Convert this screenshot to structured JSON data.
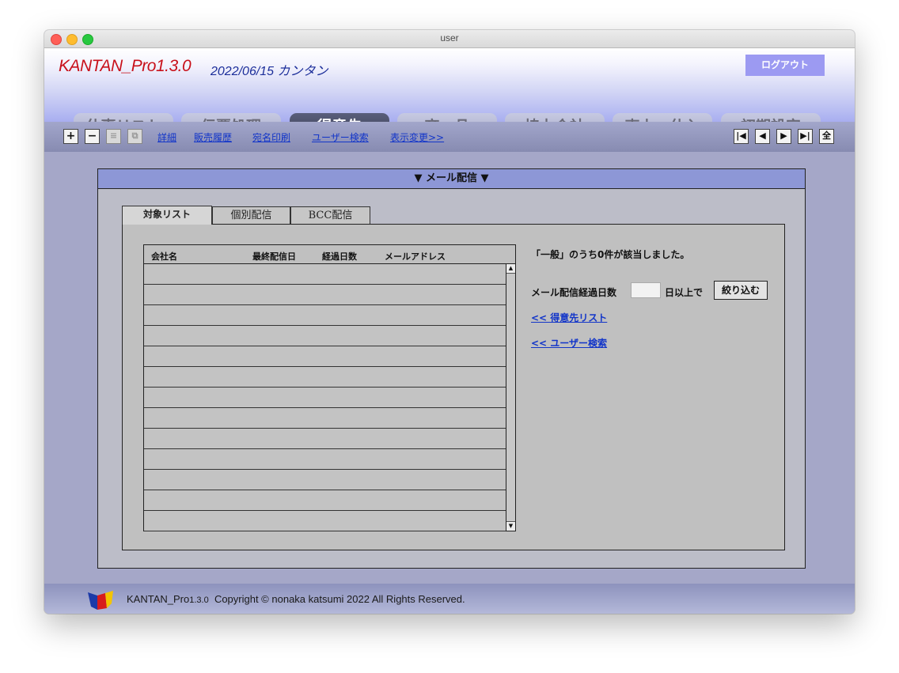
{
  "window": {
    "title": "user"
  },
  "header": {
    "app_name": "KANTAN_Pro1.3.0",
    "date_text": "2022/06/15 カンタン",
    "logout_label": "ログアウト"
  },
  "main_tabs": [
    {
      "label": "仕事リスト",
      "active": false
    },
    {
      "label": "伝票処理",
      "active": false
    },
    {
      "label": "得意先",
      "active": true
    },
    {
      "label": "商　品",
      "active": false
    },
    {
      "label": "協力会社",
      "active": false
    },
    {
      "label": "売上・仕入",
      "active": false
    },
    {
      "label": "初期設定",
      "active": false
    }
  ],
  "toolbar": {
    "buttons": [
      {
        "icon": "plus-icon",
        "glyph": "+"
      },
      {
        "icon": "minus-icon",
        "glyph": "−"
      },
      {
        "icon": "list-icon",
        "glyph": "≡"
      },
      {
        "icon": "copy-icon",
        "glyph": "⧉"
      }
    ],
    "links": [
      "詳細",
      "販売履歴",
      "宛名印刷",
      "ユーザー検索",
      "表示変更>>"
    ],
    "nav": [
      {
        "icon": "first-record-icon",
        "glyph": "|◀"
      },
      {
        "icon": "prev-record-icon",
        "glyph": "◀"
      },
      {
        "icon": "next-record-icon",
        "glyph": "▶"
      },
      {
        "icon": "last-record-icon",
        "glyph": "▶|"
      },
      {
        "icon": "all-records-icon",
        "glyph": "全"
      }
    ]
  },
  "panel": {
    "title": "▼ メール配信 ▼",
    "tabs": [
      {
        "label": "対象リスト",
        "active": true
      },
      {
        "label": "個別配信",
        "active": false
      },
      {
        "label": "BCC配信",
        "active": false
      }
    ],
    "list": {
      "columns": [
        "会社名",
        "最終配信日",
        "経過日数",
        "メールアドレス"
      ],
      "row_count": 13
    },
    "result_text": "「一般」のうち0件が該当しました。",
    "filter": {
      "label": "メール配信経過日数",
      "value": "",
      "suffix": "日以上で",
      "button_label": "絞り込む"
    },
    "links": [
      "<< 得意先リスト",
      "<< ユーザー検索"
    ]
  },
  "footer": {
    "app_name": "KANTAN_Pro",
    "version": "1.3.0",
    "copyright": "Copyright © nonaka katsumi 2022 All Rights Reserved."
  },
  "colors": {
    "brand_red": "#c8101a",
    "date_blue": "#1c2e9a",
    "link_blue": "#1235c9",
    "logout_button": "#9c9af2",
    "active_tab": "#3a3d55",
    "panel_header": "#8d97d6"
  }
}
